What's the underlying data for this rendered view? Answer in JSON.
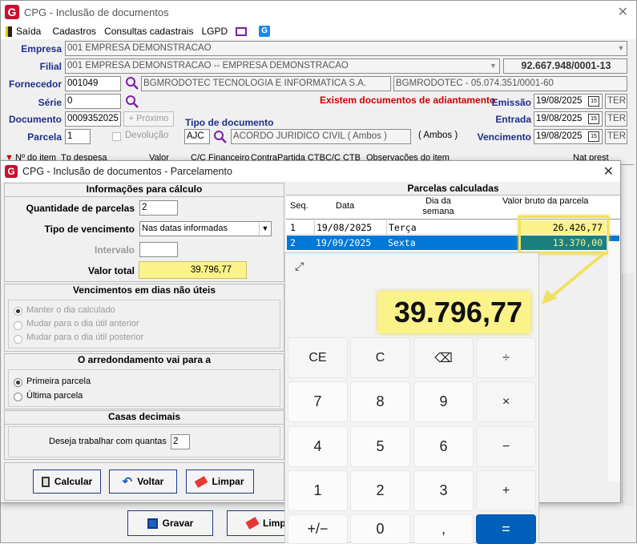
{
  "main": {
    "title": "CPG - Inclusão de documentos",
    "menu": [
      "Saída",
      "Cadastros",
      "Consultas cadastrais",
      "LGPD"
    ],
    "empresa_label": "Empresa",
    "empresa_value": "001 EMPRESA DEMONSTRACAO",
    "filial_label": "Filial",
    "filial_value": "001 EMPRESA DEMONSTRACAO -- EMPRESA DEMONSTRACAO",
    "cnpj": "92.667.948/0001-13",
    "fornecedor_label": "Fornecedor",
    "fornecedor_code": "001049",
    "fornecedor_name": "BGMRODOTEC TECNOLOGIA E INFORMATICA S.A.",
    "fornecedor_short": "BGMRODOTEC - 05.074.351/0001-60",
    "serie_label": "Série",
    "serie_value": "0",
    "adiantamento_warning": "Existem documentos de adiantamento",
    "documento_label": "Documento",
    "documento_value": "0009352025",
    "proximo_label": "Próximo",
    "tipo_doc_label": "Tipo de documento",
    "tipo_doc_code": "AJC",
    "tipo_doc_name": "ACORDO JURIDICO CIVIL ( Ambos )",
    "tipo_doc_extra": "( Ambos )",
    "parcela_label": "Parcela",
    "parcela_value": "1",
    "devolucao_label": "Devolução",
    "emissao_label": "Emissão",
    "emissao_value": "19/08/2025",
    "entrada_label": "Entrada",
    "entrada_value": "19/08/2025",
    "vencimento_label": "Vencimento",
    "vencimento_value": "19/08/2025",
    "ter": "TER",
    "grid_headers": [
      "Nº do item",
      "Tp despesa",
      "Valor",
      "C/C Financeiro",
      "ContraPartida CTB",
      "C/C CTB",
      "Observações do item",
      "Nat prest"
    ],
    "gravar_label": "Gravar",
    "limpar_label": "Limpar"
  },
  "dialog": {
    "title": "CPG - Inclusão de documentos - Parcelamento",
    "info_head": "Informações para cálculo",
    "qtd_label": "Quantidade de parcelas",
    "qtd_value": "2",
    "tipo_venc_label": "Tipo de vencimento",
    "tipo_venc_value": "Nas datas informadas",
    "intervalo_label": "Intervalo",
    "valor_total_label": "Valor total",
    "valor_total_value": "39.796,77",
    "venc_head": "Vencimentos em dias não úteis",
    "venc_opts": [
      "Manter o dia calculado",
      "Mudar para o dia útil anterior",
      "Mudar para o dia útil posterior"
    ],
    "arred_head": "O arredondamento vai para a",
    "arred_opts": [
      "Primeira parcela",
      "Última parcela"
    ],
    "casas_head": "Casas decimais",
    "casas_label": "Deseja trabalhar com quantas",
    "casas_value": "2",
    "calcular": "Calcular",
    "voltar": "Voltar",
    "limpar": "Limpar",
    "parcelas_head": "Parcelas calculadas",
    "col_seq": "Seq.",
    "col_data": "Data",
    "col_dia": "Dia da semana",
    "col_valor": "Valor bruto da parcela",
    "rows": [
      {
        "seq": "1",
        "data": "19/08/2025",
        "dia": "Terça",
        "valor": "26.426,77"
      },
      {
        "seq": "2",
        "data": "19/09/2025",
        "dia": "Sexta",
        "valor": "13.370,00"
      }
    ]
  },
  "calc": {
    "display": "39.796,77",
    "keys": [
      "CE",
      "C",
      "⌫",
      "÷",
      "7",
      "8",
      "9",
      "×",
      "4",
      "5",
      "6",
      "−",
      "1",
      "2",
      "3",
      "+",
      "+/−",
      "0",
      ",",
      "="
    ]
  },
  "colors": {
    "accent": "#1f2e8a",
    "highlight": "#fbf38a",
    "select": "#0078d7",
    "calc_eq": "#005fb8",
    "warning": "#d00000"
  }
}
